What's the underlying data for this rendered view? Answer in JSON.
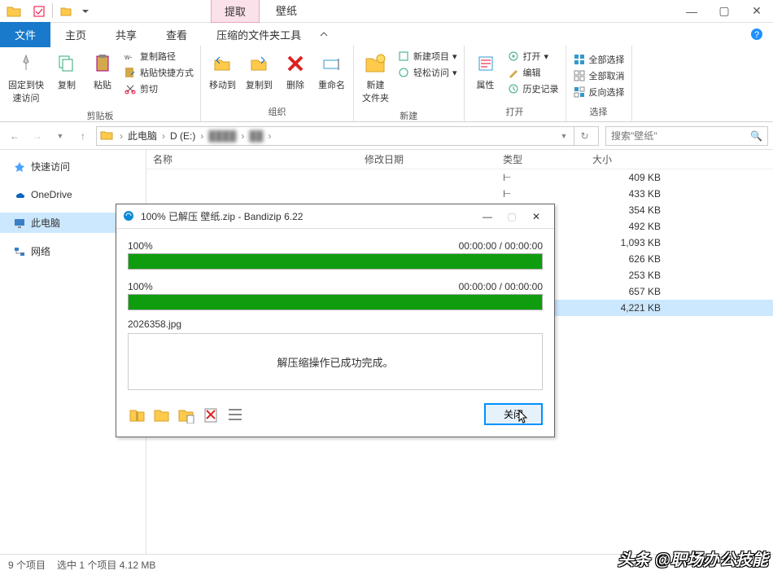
{
  "titlebar": {
    "extract_tab": "提取",
    "title_tab": "壁纸"
  },
  "menu": {
    "file": "文件",
    "home": "主页",
    "share": "共享",
    "view": "查看",
    "compressed": "压缩的文件夹工具"
  },
  "ribbon": {
    "pin": "固定到快\n速访问",
    "copy": "复制",
    "paste": "粘贴",
    "copy_path": "复制路径",
    "paste_shortcut": "粘贴快捷方式",
    "cut": "剪切",
    "g_clipboard": "剪贴板",
    "move_to": "移动到",
    "copy_to": "复制到",
    "delete": "删除",
    "rename": "重命名",
    "g_organize": "组织",
    "new_folder": "新建\n文件夹",
    "new_item": "新建项目",
    "easy_access": "轻松访问",
    "g_new": "新建",
    "properties": "属性",
    "open": "打开",
    "edit": "编辑",
    "history": "历史记录",
    "g_open": "打开",
    "select_all": "全部选择",
    "select_none": "全部取消",
    "invert": "反向选择",
    "g_select": "选择"
  },
  "nav": {
    "crumb1": "此电脑",
    "crumb2": "D (E:)",
    "crumb3_blur": "████",
    "crumb4_blur": "██",
    "search_placeholder": "搜索\"壁纸\""
  },
  "sidebar": {
    "quick": "快速访问",
    "onedrive": "OneDrive",
    "thispc": "此电脑",
    "network": "网络"
  },
  "columns": {
    "name": "名称",
    "modified": "修改日期",
    "type": "类型",
    "size": "大小"
  },
  "files": {
    "sizes": [
      "409 KB",
      "433 KB",
      "354 KB",
      "492 KB",
      "1,093 KB",
      "626 KB",
      "253 KB",
      "657 KB",
      "4,221 KB"
    ]
  },
  "dialog": {
    "title": "100% 已解压 壁纸.zip - Bandizip 6.22",
    "pct1": "100%",
    "time1": "00:00:00 / 00:00:00",
    "pct2": "100%",
    "time2": "00:00:00 / 00:00:00",
    "filename": "2026358.jpg",
    "message": "解压缩操作已成功完成。",
    "close": "关闭"
  },
  "status": {
    "items": "9 个项目",
    "selected": "选中 1 个项目  4.12 MB"
  },
  "watermark": "头条 @职场办公技能"
}
